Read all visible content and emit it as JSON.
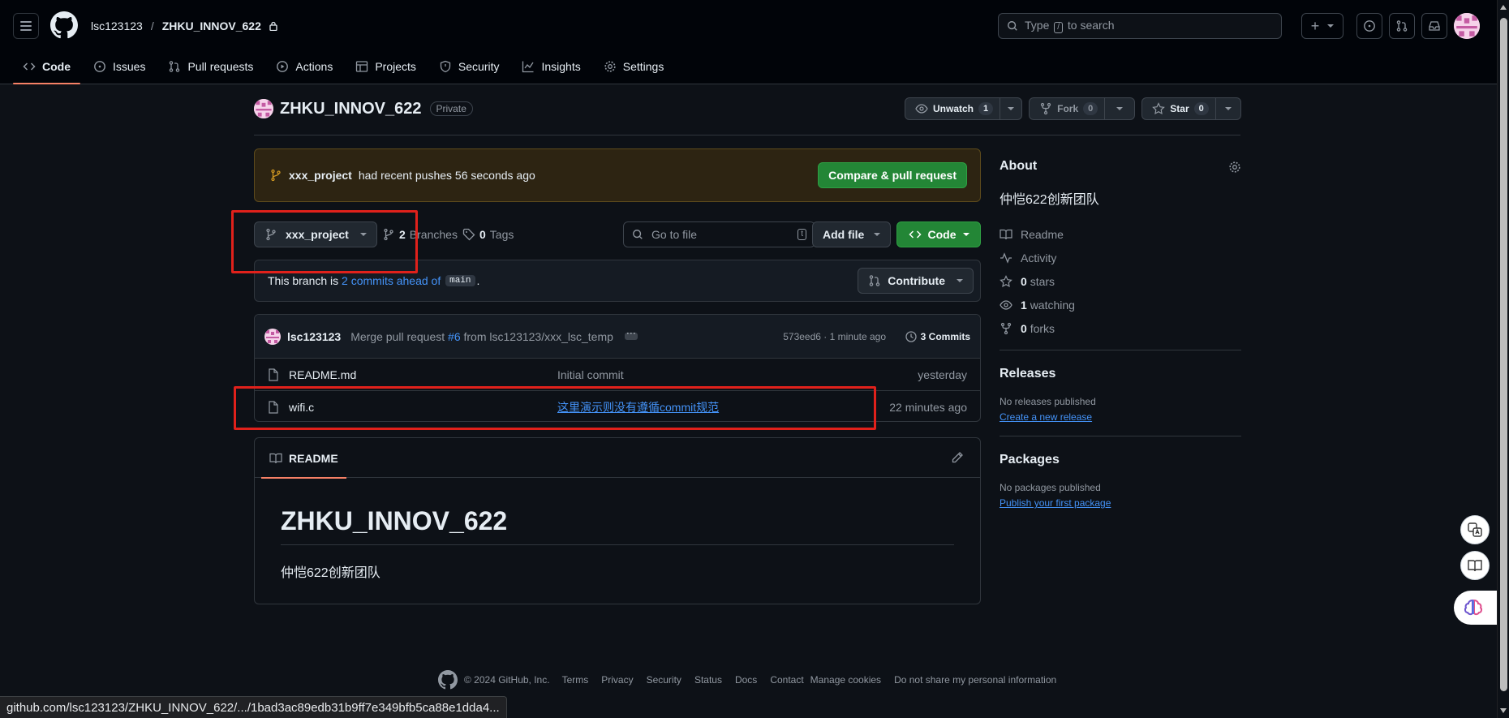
{
  "header": {
    "owner": "lsc123123",
    "separator": "/",
    "repo": "ZHKU_INNOV_622",
    "search_prefix": "Type",
    "search_key": "/",
    "search_suffix": "to search"
  },
  "nav": [
    {
      "label": "Code",
      "icon": "code-icon"
    },
    {
      "label": "Issues",
      "icon": "issue-icon"
    },
    {
      "label": "Pull requests",
      "icon": "pull-request-icon"
    },
    {
      "label": "Actions",
      "icon": "play-icon"
    },
    {
      "label": "Projects",
      "icon": "table-icon"
    },
    {
      "label": "Security",
      "icon": "shield-icon"
    },
    {
      "label": "Insights",
      "icon": "graph-icon"
    },
    {
      "label": "Settings",
      "icon": "gear-icon"
    }
  ],
  "repo": {
    "name": "ZHKU_INNOV_622",
    "visibility": "Private",
    "unwatch_label": "Unwatch",
    "watch_count": "1",
    "fork_label": "Fork",
    "fork_count": "0",
    "star_label": "Star",
    "star_count": "0"
  },
  "banner": {
    "branch": "xxx_project",
    "text": "had recent pushes 56 seconds ago",
    "button": "Compare & pull request"
  },
  "branch_bar": {
    "current_branch": "xxx_project",
    "branches_count": "2",
    "branches_label": "Branches",
    "tags_count": "0",
    "tags_label": "Tags",
    "goto_placeholder": "Go to file",
    "goto_key": "t",
    "add_file": "Add file",
    "code": "Code"
  },
  "ahead": {
    "prefix": "This branch is",
    "link": "2 commits ahead of",
    "base": "main",
    "suffix": ".",
    "contribute": "Contribute"
  },
  "latest_commit": {
    "author": "lsc123123",
    "msg_prefix": "Merge pull request",
    "pr": "#6",
    "msg_suffix": "from lsc123123/xxx_lsc_temp",
    "meta": "573eed6 · 1 minute ago",
    "commits_label": "3 Commits"
  },
  "files": [
    {
      "name": "README.md",
      "message": "Initial commit",
      "time": "yesterday",
      "message_is_link": false
    },
    {
      "name": "wifi.c",
      "message": "这里演示则没有遵循commit规范",
      "time": "22 minutes ago",
      "message_is_link": true
    }
  ],
  "readme": {
    "tab": "README",
    "heading": "ZHKU_INNOV_622",
    "body": "仲恺622创新团队"
  },
  "about": {
    "title": "About",
    "description": "仲恺622创新团队",
    "items": [
      {
        "icon": "book-icon",
        "bold": "",
        "text": "Readme"
      },
      {
        "icon": "pulse-icon",
        "bold": "",
        "text": "Activity"
      },
      {
        "icon": "star-icon",
        "bold": "0",
        "text": "stars"
      },
      {
        "icon": "eye-icon",
        "bold": "1",
        "text": "watching"
      },
      {
        "icon": "fork-icon",
        "bold": "0",
        "text": "forks"
      }
    ]
  },
  "releases": {
    "title": "Releases",
    "none": "No releases published",
    "link": "Create a new release"
  },
  "packages": {
    "title": "Packages",
    "none": "No packages published",
    "link": "Publish your first package"
  },
  "footer": {
    "copyright": "© 2024 GitHub, Inc.",
    "links": [
      "Terms",
      "Privacy",
      "Security",
      "Status",
      "Docs",
      "Contact",
      "Manage cookies",
      "Do not share my personal information"
    ]
  },
  "status_url": "github.com/lsc123123/ZHKU_INNOV_622/.../1bad3ac89edb31b9ff7e349bfb5ca88e1dda4...",
  "colors": {
    "accent_green": "#238636",
    "link_blue": "#4493f8",
    "tab_underline": "#f78166",
    "annotation_red": "#e0211b"
  }
}
